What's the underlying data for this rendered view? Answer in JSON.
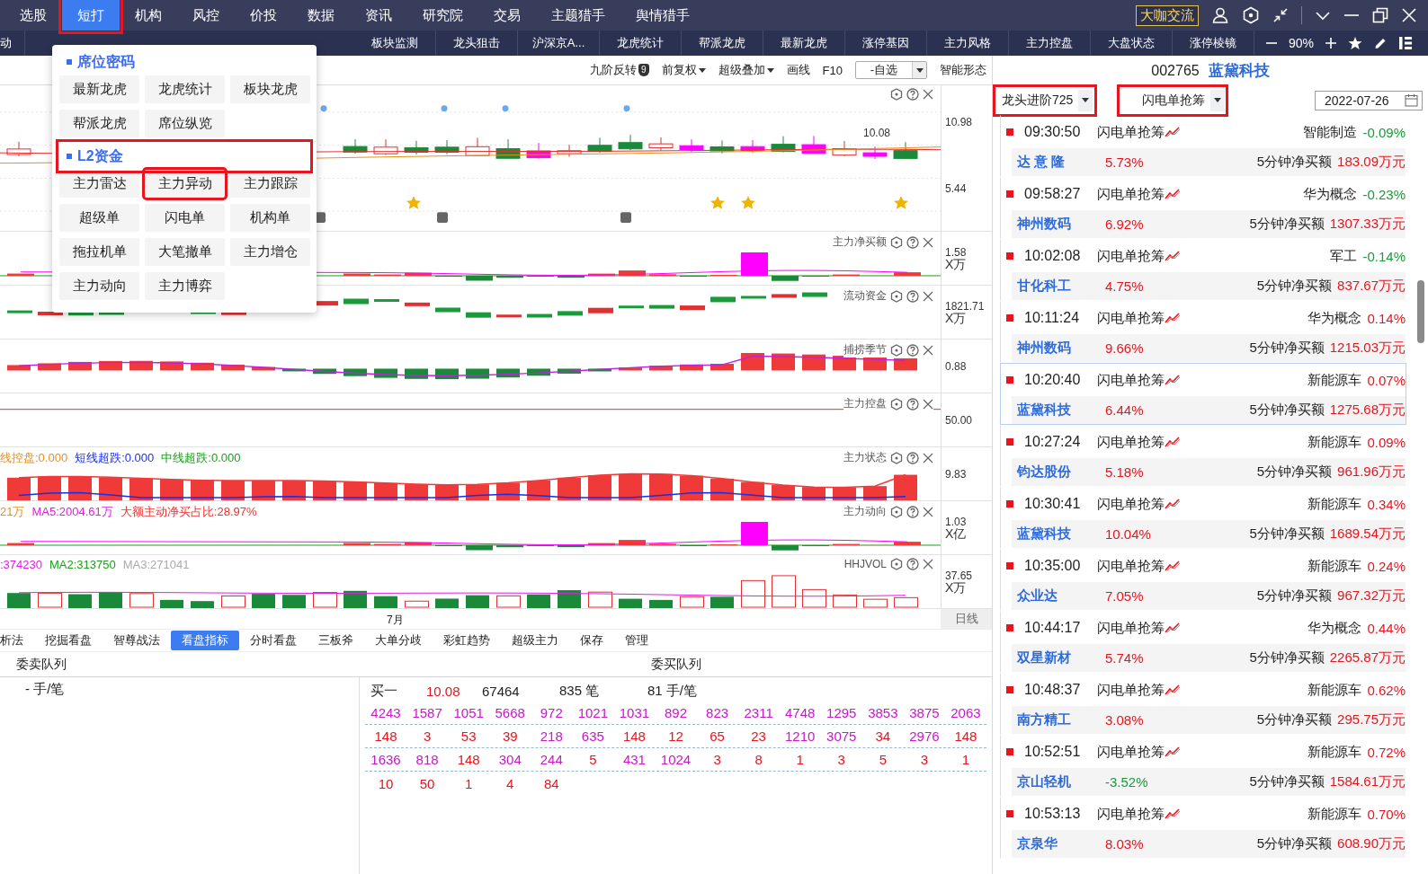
{
  "menu_bar": {
    "items": [
      {
        "label": "选股",
        "selected": false,
        "annotated": false
      },
      {
        "label": "短打",
        "selected": true,
        "annotated": true
      },
      {
        "label": "机构",
        "selected": false,
        "annotated": false
      },
      {
        "label": "风控",
        "selected": false,
        "annotated": false
      },
      {
        "label": "价投",
        "selected": false,
        "annotated": false
      },
      {
        "label": "数据",
        "selected": false,
        "annotated": false
      },
      {
        "label": "资讯",
        "selected": false,
        "annotated": false
      },
      {
        "label": "研究院",
        "selected": false,
        "annotated": false
      },
      {
        "label": "交易",
        "selected": false,
        "annotated": false
      },
      {
        "label": "主题猎手",
        "selected": false,
        "annotated": false
      },
      {
        "label": "舆情猎手",
        "selected": false,
        "annotated": false
      }
    ],
    "community_button": "大咖交流"
  },
  "tab_bar": {
    "first_tab": "动",
    "tabs": [
      "板块监测",
      "龙头狙击",
      "沪深京A...",
      "龙虎统计",
      "帮派龙虎",
      "最新龙虎",
      "涨停基因",
      "主力风格",
      "主力控盘",
      "大盘状态",
      "涨停棱镜"
    ],
    "zoom": "90%"
  },
  "dropdown_menu": {
    "sections": [
      {
        "title": "席位密码",
        "annotated": false,
        "items": [
          {
            "label": "最新龙虎",
            "annotated": false
          },
          {
            "label": "龙虎统计",
            "annotated": false
          },
          {
            "label": "板块龙虎",
            "annotated": false
          },
          {
            "label": "帮派龙虎",
            "annotated": false
          },
          {
            "label": "席位纵览",
            "annotated": false
          }
        ]
      },
      {
        "title": "L2资金",
        "annotated": true,
        "items": [
          {
            "label": "主力雷达",
            "annotated": false
          },
          {
            "label": "主力异动",
            "annotated": true
          },
          {
            "label": "主力跟踪",
            "annotated": false
          },
          {
            "label": "超级单",
            "annotated": false
          },
          {
            "label": "闪电单",
            "annotated": false
          },
          {
            "label": "机构单",
            "annotated": false
          },
          {
            "label": "拖拉机单",
            "annotated": false
          },
          {
            "label": "大笔撤单",
            "annotated": false
          },
          {
            "label": "主力增仓",
            "annotated": false
          },
          {
            "label": "主力动向",
            "annotated": false
          },
          {
            "label": "主力博弈",
            "annotated": false
          }
        ]
      }
    ]
  },
  "toolbar": {
    "items": [
      {
        "kind": "badge",
        "label": "九阶反转",
        "badge": "9"
      },
      {
        "kind": "dropdown",
        "label": "前复权"
      },
      {
        "kind": "dropdown",
        "label": "超级叠加"
      },
      {
        "kind": "plain",
        "label": "画线"
      },
      {
        "kind": "plain",
        "label": "F10"
      },
      {
        "kind": "select",
        "label": "-自选"
      },
      {
        "kind": "plain",
        "label": "智能形态"
      }
    ]
  },
  "chart": {
    "main": {
      "y_labels": [
        "10.98",
        "5.44"
      ],
      "price_tag": "10.08"
    },
    "panels": [
      {
        "title": "主力净买额",
        "kind": "bars",
        "value": "1.58",
        "unit": "X万"
      },
      {
        "title": "流动资金",
        "kind": "dashes",
        "value": "1821.71",
        "unit": "X万"
      },
      {
        "title": "捕捞季节",
        "kind": "wave",
        "value": "0.88"
      },
      {
        "title": "主力控盘",
        "kind": "line",
        "value": "50.00"
      },
      {
        "title": "主力状态",
        "kind": "columns",
        "value": "9.83",
        "legend": [
          {
            "text": "线控盘:0.000",
            "color": "#e8901a"
          },
          {
            "text": "短线超跌:0.000",
            "color": "#1a2ee8"
          },
          {
            "text": "中线超跌:0.000",
            "color": "#1aa01a"
          }
        ]
      },
      {
        "title": "主力动向",
        "kind": "bars",
        "value": "1.03",
        "unit": "X亿",
        "legend": [
          {
            "text": "21万",
            "color": "#e8901a"
          },
          {
            "text": "MA5:2004.61万",
            "color": "#e020e0"
          },
          {
            "text": "大额主动净买占比:28.97%",
            "color": "#f03030"
          }
        ]
      },
      {
        "title": "HHJVOL",
        "kind": "volume",
        "value": "37.65",
        "unit": "X万",
        "legend": [
          {
            "text": ":374230",
            "color": "#e020e0"
          },
          {
            "text": "MA2:313750",
            "color": "#1aa01a"
          },
          {
            "text": "MA3:271041",
            "color": "#aaaaaa"
          }
        ]
      }
    ],
    "x_label": "7月",
    "period": "日线"
  },
  "bottom_tabs": [
    {
      "label": "析法",
      "selected": false
    },
    {
      "label": "挖掘看盘",
      "selected": false
    },
    {
      "label": "智尊战法",
      "selected": false
    },
    {
      "label": "看盘指标",
      "selected": true
    },
    {
      "label": "分时看盘",
      "selected": false
    },
    {
      "label": "三板斧",
      "selected": false
    },
    {
      "label": "大单分歧",
      "selected": false
    },
    {
      "label": "彩虹趋势",
      "selected": false
    },
    {
      "label": "超级主力",
      "selected": false
    },
    {
      "label": "保存",
      "selected": false
    },
    {
      "label": "管理",
      "selected": false
    }
  ],
  "queue": {
    "sell_title": "委卖队列",
    "sell_unit": "- 手/笔",
    "buy_title": "委买队列",
    "summary": {
      "label": "买一",
      "price": "10.08",
      "volume": "67464",
      "orders": "835 笔",
      "average": "81 手/笔"
    },
    "rows": [
      [
        {
          "v": "4243",
          "large": true
        },
        {
          "v": "1587",
          "large": true
        },
        {
          "v": "1051",
          "large": true
        },
        {
          "v": "5668",
          "large": true
        },
        {
          "v": "972",
          "large": true
        },
        {
          "v": "1021",
          "large": true
        },
        {
          "v": "1031",
          "large": true
        },
        {
          "v": "892",
          "large": true
        },
        {
          "v": "823",
          "large": true
        },
        {
          "v": "2311",
          "large": true
        },
        {
          "v": "4748",
          "large": true
        },
        {
          "v": "1295",
          "large": true
        },
        {
          "v": "3853",
          "large": true
        },
        {
          "v": "3875",
          "large": true
        },
        {
          "v": "2063",
          "large": true
        }
      ],
      [
        {
          "v": "148",
          "large": false
        },
        {
          "v": "3",
          "large": false
        },
        {
          "v": "53",
          "large": false
        },
        {
          "v": "39",
          "large": false
        },
        {
          "v": "218",
          "large": true
        },
        {
          "v": "635",
          "large": true
        },
        {
          "v": "148",
          "large": false
        },
        {
          "v": "12",
          "large": false
        },
        {
          "v": "65",
          "large": false
        },
        {
          "v": "23",
          "large": false
        },
        {
          "v": "1210",
          "large": true
        },
        {
          "v": "3075",
          "large": true
        },
        {
          "v": "34",
          "large": false
        },
        {
          "v": "2976",
          "large": true
        },
        {
          "v": "148",
          "large": false
        }
      ],
      [
        {
          "v": "1636",
          "large": true
        },
        {
          "v": "818",
          "large": true
        },
        {
          "v": "148",
          "large": false
        },
        {
          "v": "304",
          "large": true
        },
        {
          "v": "244",
          "large": true
        },
        {
          "v": "5",
          "large": false
        },
        {
          "v": "431",
          "large": true
        },
        {
          "v": "1024",
          "large": true
        },
        {
          "v": "3",
          "large": false
        },
        {
          "v": "8",
          "large": false
        },
        {
          "v": "1",
          "large": false
        },
        {
          "v": "3",
          "large": false
        },
        {
          "v": "5",
          "large": false
        },
        {
          "v": "3",
          "large": false
        },
        {
          "v": "1",
          "large": false
        }
      ],
      [
        {
          "v": "10",
          "large": false
        },
        {
          "v": "50",
          "large": false
        },
        {
          "v": "1",
          "large": false
        },
        {
          "v": "4",
          "large": false
        },
        {
          "v": "84",
          "large": false
        }
      ]
    ]
  },
  "stock": {
    "code": "002765",
    "name": "蓝黛科技"
  },
  "filters": [
    {
      "label": "龙头进阶725",
      "annotated": true
    },
    {
      "label": "闪电单抢筹",
      "annotated": true
    }
  ],
  "date": "2022-07-26",
  "feed": [
    {
      "time": "09:30:50",
      "signal": "闪电单抢筹",
      "sector": "智能制造",
      "sector_change": "-0.09%",
      "sector_up": false,
      "stock": "达 意 隆",
      "change": "5.73%",
      "change_up": true,
      "metric": "5分钟净买额",
      "amount": "183.09万元",
      "selected": false
    },
    {
      "time": "09:58:27",
      "signal": "闪电单抢筹",
      "sector": "华为概念",
      "sector_change": "-0.23%",
      "sector_up": false,
      "stock": "神州数码",
      "change": "6.92%",
      "change_up": true,
      "metric": "5分钟净买额",
      "amount": "1307.33万元",
      "selected": false
    },
    {
      "time": "10:02:08",
      "signal": "闪电单抢筹",
      "sector": "军工",
      "sector_change": "-0.14%",
      "sector_up": false,
      "stock": "甘化科工",
      "change": "4.75%",
      "change_up": true,
      "metric": "5分钟净买额",
      "amount": "837.67万元",
      "selected": false
    },
    {
      "time": "10:11:24",
      "signal": "闪电单抢筹",
      "sector": "华为概念",
      "sector_change": "0.14%",
      "sector_up": true,
      "stock": "神州数码",
      "change": "9.66%",
      "change_up": true,
      "metric": "5分钟净买额",
      "amount": "1215.03万元",
      "selected": false
    },
    {
      "time": "10:20:40",
      "signal": "闪电单抢筹",
      "sector": "新能源车",
      "sector_change": "0.07%",
      "sector_up": true,
      "stock": "蓝黛科技",
      "change": "6.44%",
      "change_up": true,
      "metric": "5分钟净买额",
      "amount": "1275.68万元",
      "selected": true
    },
    {
      "time": "10:27:24",
      "signal": "闪电单抢筹",
      "sector": "新能源车",
      "sector_change": "0.09%",
      "sector_up": true,
      "stock": "钧达股份",
      "change": "5.18%",
      "change_up": true,
      "metric": "5分钟净买额",
      "amount": "961.96万元",
      "selected": false
    },
    {
      "time": "10:30:41",
      "signal": "闪电单抢筹",
      "sector": "新能源车",
      "sector_change": "0.34%",
      "sector_up": true,
      "stock": "蓝黛科技",
      "change": "10.04%",
      "change_up": true,
      "metric": "5分钟净买额",
      "amount": "1689.54万元",
      "selected": false
    },
    {
      "time": "10:35:00",
      "signal": "闪电单抢筹",
      "sector": "新能源车",
      "sector_change": "0.24%",
      "sector_up": true,
      "stock": "众业达",
      "change": "7.05%",
      "change_up": true,
      "metric": "5分钟净买额",
      "amount": "967.32万元",
      "selected": false
    },
    {
      "time": "10:44:17",
      "signal": "闪电单抢筹",
      "sector": "华为概念",
      "sector_change": "0.44%",
      "sector_up": true,
      "stock": "双星新材",
      "change": "5.74%",
      "change_up": true,
      "metric": "5分钟净买额",
      "amount": "2265.87万元",
      "selected": false
    },
    {
      "time": "10:48:37",
      "signal": "闪电单抢筹",
      "sector": "新能源车",
      "sector_change": "0.62%",
      "sector_up": true,
      "stock": "南方精工",
      "change": "3.08%",
      "change_up": true,
      "metric": "5分钟净买额",
      "amount": "295.75万元",
      "selected": false
    },
    {
      "time": "10:52:51",
      "signal": "闪电单抢筹",
      "sector": "新能源车",
      "sector_change": "0.72%",
      "sector_up": true,
      "stock": "京山轻机",
      "change": "-3.52%",
      "change_up": false,
      "metric": "5分钟净买额",
      "amount": "1584.61万元",
      "selected": false
    },
    {
      "time": "10:53:13",
      "signal": "闪电单抢筹",
      "sector": "新能源车",
      "sector_change": "0.70%",
      "sector_up": true,
      "stock": "京泉华",
      "change": "8.03%",
      "change_up": true,
      "metric": "5分钟净买额",
      "amount": "608.90万元",
      "selected": false
    }
  ]
}
